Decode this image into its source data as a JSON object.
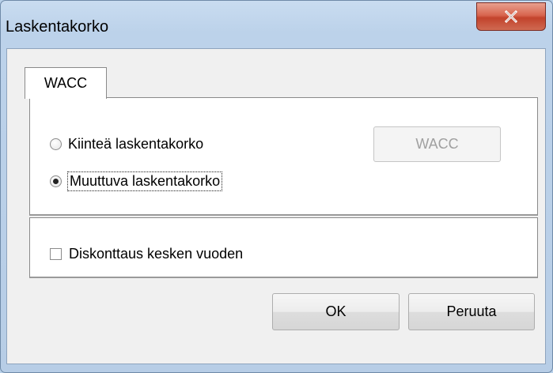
{
  "window": {
    "title": "Laskentakorko",
    "close_icon": "close-icon"
  },
  "tabs": [
    {
      "label": "WACC",
      "selected": true
    }
  ],
  "rate_options": [
    {
      "label": "Kiinteä laskentakorko",
      "checked": false
    },
    {
      "label": "Muuttuva laskentakorko",
      "checked": true
    }
  ],
  "wacc_button": {
    "label": "WACC",
    "enabled": false
  },
  "discount_checkbox": {
    "label": "Diskonttaus kesken vuoden",
    "checked": false
  },
  "buttons": {
    "ok": "OK",
    "cancel": "Peruuta"
  },
  "colors": {
    "frame": "#b9d1ea",
    "close_button": "#c2432c",
    "panel": "#ffffff",
    "dialog_face": "#f0f0f0"
  }
}
